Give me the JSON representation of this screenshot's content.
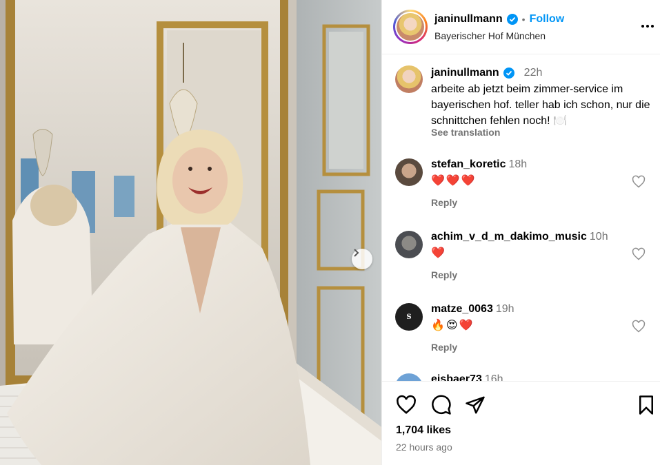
{
  "post": {
    "username": "janinullmann",
    "follow_label": "Follow",
    "location": "Bayerischer Hof München",
    "separator": "•"
  },
  "caption": {
    "username": "janinullmann",
    "time": "22h",
    "text": "arbeite ab jetzt beim zimmer-service im bayerischen hof. teller hab ich schon, nur die schnittchen fehlen noch! 🍽️",
    "see_translation": "See translation"
  },
  "comments": [
    {
      "username": "stefan_koretic",
      "time": "18h",
      "text": "❤️❤️❤️",
      "reply": "Reply",
      "avatar_color": "#5a4a3e"
    },
    {
      "username": "achim_v_d_m_dakimo_music",
      "time": "10h",
      "text": "❤️",
      "reply": "Reply",
      "avatar_color": "#4b4d52"
    },
    {
      "username": "matze_0063",
      "time": "19h",
      "text": "🔥😍❤️",
      "reply": "Reply",
      "avatar_color": "#1f1f1f"
    },
    {
      "username": "eisbaer73",
      "time": "16h",
      "text": "",
      "reply": "",
      "avatar_color": "#6ea2d6"
    }
  ],
  "stats": {
    "likes": "1,704 likes",
    "time_ago": "22 hours ago"
  },
  "icons": {
    "verified": "verified-badge-icon",
    "more": "more-options-icon",
    "like": "heart-icon",
    "comment": "comment-icon",
    "share": "share-icon",
    "save": "bookmark-icon",
    "next": "chevron-right-icon"
  },
  "colors": {
    "accent": "#0095f6",
    "muted": "#737373",
    "border": "#efefef"
  }
}
